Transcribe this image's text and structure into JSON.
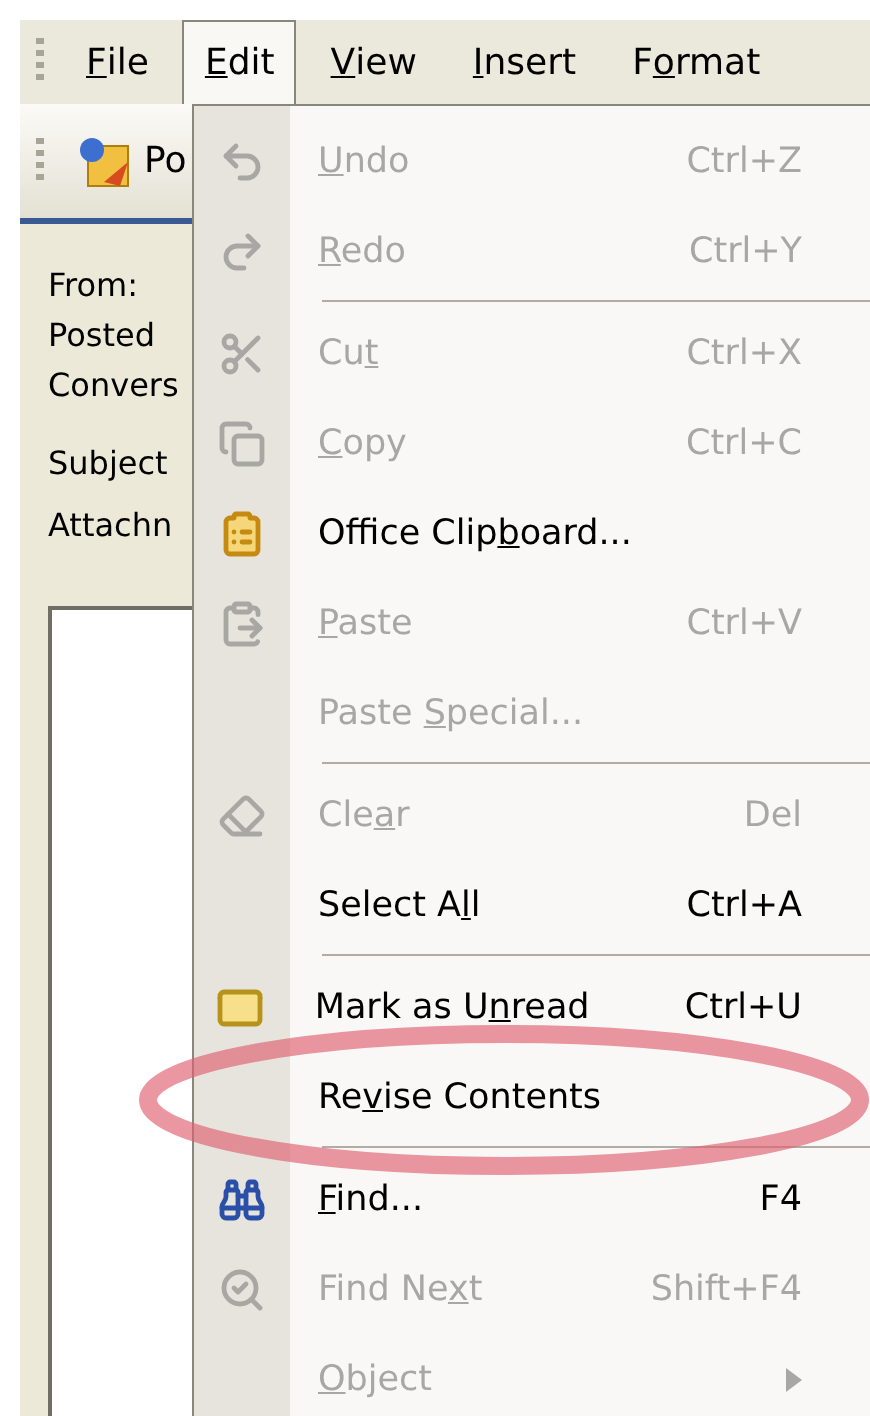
{
  "menu_bar": [
    {
      "key": "F",
      "after": "ile",
      "selected": false
    },
    {
      "key": "E",
      "after": "dit",
      "selected": true
    },
    {
      "key": "V",
      "after": "iew",
      "selected": false
    },
    {
      "key": "I",
      "after": "nsert",
      "selected": false
    },
    {
      "before": "F",
      "key": "o",
      "after": "rmat",
      "selected": false
    }
  ],
  "toolbar": {
    "button_label": "Po"
  },
  "form_labels": [
    "From:",
    "Posted",
    "Convers",
    "Subject",
    "Attachn"
  ],
  "edit_menu": [
    {
      "kind": "item",
      "key": "U",
      "after": "ndo",
      "shortcut": "Ctrl+Z",
      "disabled": true
    },
    {
      "kind": "item",
      "key": "R",
      "after": "edo",
      "shortcut": "Ctrl+Y",
      "disabled": true
    },
    {
      "kind": "separator"
    },
    {
      "kind": "item",
      "before": "Cu",
      "key": "t",
      "shortcut": "Ctrl+X",
      "disabled": true
    },
    {
      "kind": "item",
      "key": "C",
      "after": "opy",
      "shortcut": "Ctrl+C",
      "disabled": true
    },
    {
      "kind": "item",
      "before": "Office Clip",
      "key": "b",
      "after": "oard...",
      "disabled": false
    },
    {
      "kind": "item",
      "key": "P",
      "after": "aste",
      "shortcut": "Ctrl+V",
      "disabled": true
    },
    {
      "kind": "item",
      "before": "Paste ",
      "key": "S",
      "after": "pecial...",
      "disabled": true
    },
    {
      "kind": "separator"
    },
    {
      "kind": "item",
      "before": "Cle",
      "key": "a",
      "after": "r",
      "shortcut": "Del",
      "disabled": true
    },
    {
      "kind": "item",
      "before": "Select A",
      "key": "l",
      "after": "l",
      "shortcut": "Ctrl+A",
      "disabled": false
    },
    {
      "kind": "separator"
    },
    {
      "kind": "item",
      "before": "Mark as U",
      "key": "n",
      "after": "read",
      "shortcut": "Ctrl+U",
      "disabled": false
    },
    {
      "kind": "item",
      "before": "Re",
      "key": "v",
      "after": "ise Contents",
      "disabled": false,
      "highlighted": true
    },
    {
      "kind": "separator"
    },
    {
      "kind": "item",
      "key": "F",
      "after": "ind...",
      "shortcut": "F4",
      "disabled": false
    },
    {
      "kind": "item",
      "before": "Find Ne",
      "key": "x",
      "after": "t",
      "shortcut": "Shift+F4",
      "disabled": true
    },
    {
      "kind": "submenu",
      "key": "O",
      "after": "bject",
      "disabled": true
    }
  ]
}
